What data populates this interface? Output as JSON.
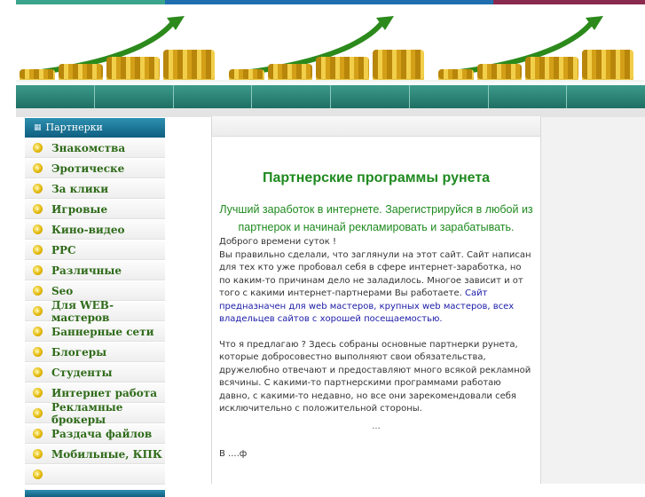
{
  "colors": {
    "accent_green": "#1f8a1f",
    "menu_teal": "#1e6f63",
    "sidebar_blue": "#0f5f80"
  },
  "sidebar": {
    "title": "Партнерки",
    "items": [
      {
        "label": "Знакомства"
      },
      {
        "label": "Эротическе"
      },
      {
        "label": "За клики"
      },
      {
        "label": "Игровые"
      },
      {
        "label": "Кино-видео"
      },
      {
        "label": "PPC"
      },
      {
        "label": "Различные"
      },
      {
        "label": "Seo"
      },
      {
        "label": "Для WEB-мастеров"
      },
      {
        "label": "Баннерные сети"
      },
      {
        "label": "Блогеры"
      },
      {
        "label": "Студенты"
      },
      {
        "label": "Интернет работа"
      },
      {
        "label": "Рекламные брокеры"
      },
      {
        "label": "Раздача файлов"
      },
      {
        "label": "Мобильные, КПК"
      },
      {
        "label": ""
      }
    ]
  },
  "main": {
    "title": "Партнерские программы рунета",
    "lead": "Лучший заработок в интернете. Зарегистрируйся в любой из партнерок и начинай рекламировать и зарабатывать.",
    "p1_greeting": "Доброго времени суток !",
    "p1_text": "Вы правильно сделали, что заглянули на этот сайт. Сайт написан для тех кто уже пробовал себя в сфере интернет-заработка, но по каким-то причинам дело не заладилось. Многое зависит и от того с какими интернет-партнерами Вы работаете.",
    "p1_link": "Сайт предназначен для web мастеров, крупных web мастеров, всех владельцев сайтов с хорошей посещаемостью.",
    "p2_text": "Что я предлагаю ? Здесь собраны основные партнерки рунета, которые добросовестно выполняют свои обязательства, дружелюбно отвечают и предоставляют много всякой рекламной всячины. С какими-то партнерскими программами работаю давно, с какими-то недавно, но все они зарекомендовали себя исключительно с положительной стороны.",
    "ellipsis": "...",
    "trail": "В ....ф"
  }
}
